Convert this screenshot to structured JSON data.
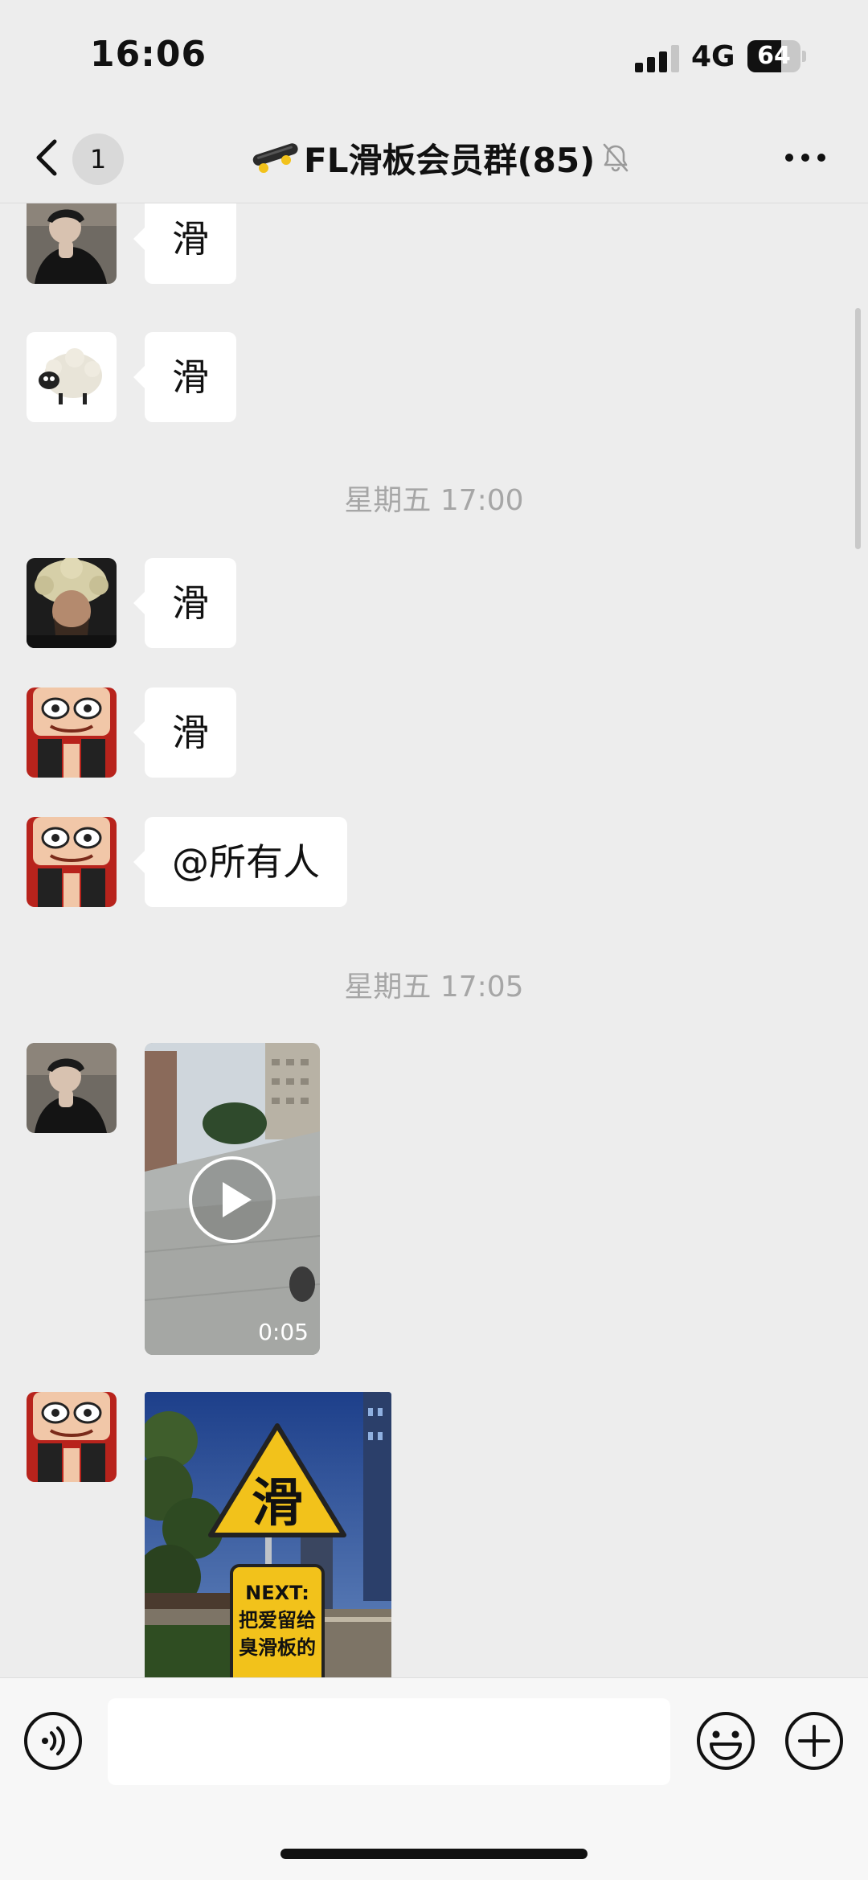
{
  "status_bar": {
    "time": "16:06",
    "network": "4G",
    "battery": "64",
    "battery_level": 0.64
  },
  "nav": {
    "unread_count": "1",
    "title": "FL滑板会员群(85)"
  },
  "messages": [
    {
      "type": "text",
      "text": "滑"
    },
    {
      "type": "text",
      "text": "滑"
    },
    {
      "type": "timestamp",
      "text": "星期五 17:00"
    },
    {
      "type": "text",
      "text": "滑"
    },
    {
      "type": "text",
      "text": "滑"
    },
    {
      "type": "text",
      "text": "@所有人"
    },
    {
      "type": "timestamp",
      "text": "星期五 17:05"
    },
    {
      "type": "video",
      "duration": "0:05"
    },
    {
      "type": "image",
      "sign_char": "滑",
      "sign_next": "NEXT:",
      "sign_line1": "把爱留给",
      "sign_line2": "臭滑板的"
    }
  ],
  "input": {
    "placeholder": ""
  },
  "colors": {
    "background": "#ededed",
    "bubble": "#ffffff",
    "sign_yellow": "#f2c21b"
  }
}
